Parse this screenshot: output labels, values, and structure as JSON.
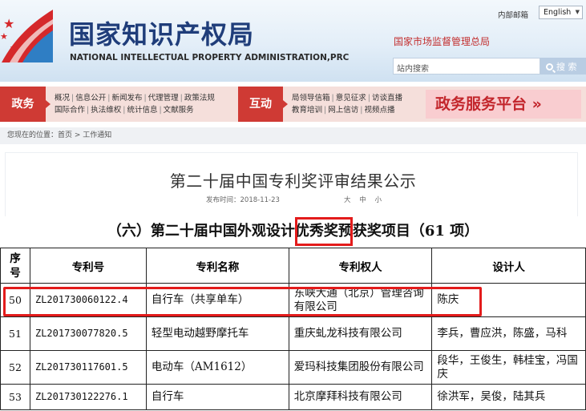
{
  "header": {
    "site_title": "国家知识产权局",
    "site_subtitle": "NATIONAL INTELLECTUAL PROPERTY ADMINISTRATION,PRC",
    "top_link": "内部邮箱",
    "language": "English",
    "samr_link": "国家市场监督管理总局",
    "search_placeholder": "站内搜索",
    "search_button": "搜 索"
  },
  "nav": {
    "cat1": "政务",
    "cat1_row1": [
      "概况",
      "信息公开",
      "新闻发布",
      "代理管理",
      "政策法规"
    ],
    "cat1_row2": [
      "国际合作",
      "执法维权",
      "统计信息",
      "文献服务"
    ],
    "cat2": "互动",
    "cat2_row1": [
      "局领导信箱",
      "意见征求",
      "访谈直播"
    ],
    "cat2_row2": [
      "教育培训",
      "网上信访",
      "视频点播"
    ],
    "service_platform": "政务服务平台 »"
  },
  "breadcrumb": "您现在的位置：首页 > 工作通知",
  "article": {
    "title": "第二十届中国专利奖评审结果公示",
    "meta": "发布时间：2018-11-23",
    "font_sizes": [
      "大",
      "中",
      "小"
    ]
  },
  "section_heading": "（六）第二十届中国外观设计优秀奖预获奖项目（61 项）",
  "table": {
    "headers": [
      "序号",
      "专利号",
      "专利名称",
      "专利权人",
      "设计人"
    ],
    "rows": [
      [
        "50",
        "ZL201730060122.4",
        "自行车（共享单车）",
        "东峡大通（北京）管理咨询有限公司",
        "陈庆"
      ],
      [
        "51",
        "ZL201730077820.5",
        "轻型电动越野摩托车",
        "重庆虬龙科技有限公司",
        "李兵，曹应洪，陈盛，马科"
      ],
      [
        "52",
        "ZL201730117601.5",
        "电动车（AM1612）",
        "爱玛科技集团股份有限公司",
        "段华，王俊生，韩桂宝，冯国庆"
      ],
      [
        "53",
        "ZL201730122276.1",
        "自行车",
        "北京摩拜科技有限公司",
        "徐洪军，吴俊，陆其兵"
      ]
    ]
  },
  "colors": {
    "accent_red": "#cf3a34",
    "brand_blue": "#1f3d7a",
    "highlight_red": "#e31b1b"
  }
}
